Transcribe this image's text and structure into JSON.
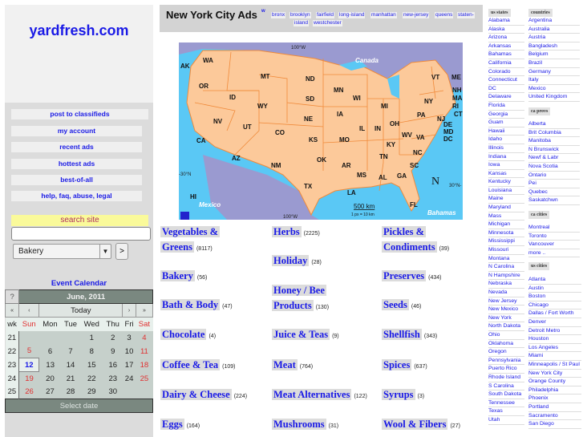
{
  "site": {
    "logo": "yardfresh.com"
  },
  "nav": [
    "post to classifieds",
    "my account",
    "recent ads",
    "hottest ads",
    "best-of-all",
    "help, faq, abuse, legal"
  ],
  "search": {
    "label": "search site",
    "query": "",
    "category_selected": "Bakery",
    "go_label": ">"
  },
  "calendar": {
    "title": "Event Calendar",
    "help": "?",
    "month": "June, 2011",
    "prev_year": "«",
    "prev_month": "‹",
    "today": "Today",
    "next_month": "›",
    "next_year": "»",
    "wk_label": "wk",
    "days": [
      "Sun",
      "Mon",
      "Tue",
      "Wed",
      "Thu",
      "Fri",
      "Sat"
    ],
    "weeks": [
      {
        "wk": "21",
        "d": [
          "",
          "",
          "",
          "1",
          "2",
          "3",
          "4"
        ]
      },
      {
        "wk": "22",
        "d": [
          "5",
          "6",
          "7",
          "8",
          "9",
          "10",
          "11"
        ]
      },
      {
        "wk": "23",
        "d": [
          "12",
          "13",
          "14",
          "15",
          "16",
          "17",
          "18"
        ]
      },
      {
        "wk": "24",
        "d": [
          "19",
          "20",
          "21",
          "22",
          "23",
          "24",
          "25"
        ]
      },
      {
        "wk": "25",
        "d": [
          "26",
          "27",
          "28",
          "29",
          "30",
          "",
          ""
        ]
      }
    ],
    "selected": "12",
    "footer": "Select date"
  },
  "header": {
    "title": "New York City Ads",
    "w_link": "w",
    "links": [
      "bronx",
      "brooklyn",
      "fairfield",
      "long-island",
      "manhattan",
      "new-jersey",
      "queens",
      "staten-",
      "island",
      "westchester"
    ]
  },
  "map": {
    "labels": {
      "canada": "Canada",
      "mexico": "Mexico",
      "bahamas": "Bahamas",
      "lon_top": "100°W",
      "lon_bottom": "100°W",
      "lat_left": "-30°N",
      "lat_right": "30°N-",
      "scale": "500 km",
      "scale_note": "1 px = 10 km",
      "north": "N",
      "hi": "HI",
      "ak": "AK"
    },
    "states": [
      "WA",
      "OR",
      "CA",
      "ID",
      "NV",
      "MT",
      "WY",
      "UT",
      "AZ",
      "CO",
      "NM",
      "ND",
      "SD",
      "NE",
      "KS",
      "OK",
      "TX",
      "MN",
      "IA",
      "MO",
      "AR",
      "LA",
      "WI",
      "IL",
      "MS",
      "MI",
      "IN",
      "KY",
      "TN",
      "AL",
      "OH",
      "GA",
      "FL",
      "SC",
      "NC",
      "VA",
      "WV",
      "PA",
      "NY",
      "VT",
      "ME",
      "NH",
      "MA",
      "RI",
      "CT",
      "NJ",
      "DE",
      "MD",
      "DC"
    ]
  },
  "categories": [
    {
      "name": "Vegetables &",
      "name2": "Greens",
      "count": "(8117)"
    },
    {
      "name": "Bakery",
      "count": "(56)"
    },
    {
      "name": "Bath & Body",
      "count": "(47)"
    },
    {
      "name": "Chocolate",
      "count": "(4)"
    },
    {
      "name": "Coffee & Tea",
      "count": "(109)"
    },
    {
      "name": "Dairy & Cheese",
      "count": "(224)"
    },
    {
      "name": "Eggs",
      "count": "(164)"
    },
    {
      "name": "Herbs",
      "count": "(2225)"
    },
    {
      "name": "Holiday",
      "count": "(28)"
    },
    {
      "name": "Honey / Bee",
      "name2": "Products",
      "count": "(130)"
    },
    {
      "name": "Juice & Teas",
      "count": "(9)"
    },
    {
      "name": "Meat",
      "count": "(764)"
    },
    {
      "name": "Meat Alternatives",
      "count": "(122)"
    },
    {
      "name": "Mushrooms",
      "count": "(31)"
    },
    {
      "name": "Pickles &",
      "name2": "Condiments",
      "count": "(39)"
    },
    {
      "name": "Preserves",
      "count": "(434)"
    },
    {
      "name": "Seeds",
      "count": "(46)"
    },
    {
      "name": "Shellfish",
      "count": "(343)"
    },
    {
      "name": "Spices",
      "count": "(637)"
    },
    {
      "name": "Syrups",
      "count": "(3)"
    },
    {
      "name": "Wool & Fibers",
      "count": "(27)"
    }
  ],
  "right": {
    "us_states_head": "us states",
    "us_states": [
      "Alabama",
      "Alaska",
      "Arizona",
      "Arkansas",
      "Bahamas",
      "California",
      "Colorado",
      "Connecticut",
      "DC",
      "Delaware",
      "Florida",
      "Georgia",
      "Guam",
      "Hawaii",
      "Idaho",
      "Illinois",
      "Indiana",
      "Iowa",
      "Kansas",
      "Kentucky",
      "Louisiana",
      "Maine",
      "Maryland",
      "Mass",
      "Michigan",
      "Minnesota",
      "Mississippi",
      "Missouri",
      "Montana",
      "N Carolina",
      "N Hampshire",
      "Nebraska",
      "Nevada",
      "New Jersey",
      "New Mexico",
      "New York",
      "North Dakota",
      "Ohio",
      "Oklahoma",
      "Oregon",
      "Pennsylvania",
      "Puerto Rico",
      "Rhode Island",
      "S Carolina",
      "South Dakota",
      "Tennessee",
      "Texas",
      "Utah"
    ],
    "countries_head": "countries",
    "countries": [
      "Argentina",
      "Australia",
      "Austria",
      "Bangladesh",
      "Belgium",
      "Brazil",
      "Germany",
      "Italy",
      "Mexico",
      "United Kingdom"
    ],
    "ca_provs_head": "ca provs",
    "ca_provs": [
      "Alberta",
      "Brit Columbia",
      "Manitoba",
      "N Brunswick",
      "Newf & Labr",
      "Nova Scotia",
      "Ontario",
      "Pei",
      "Quebec",
      "Saskatchwn"
    ],
    "ca_cities_head": "ca cities",
    "ca_cities": [
      "Montreal",
      "Toronto",
      "Vancouver",
      "more .."
    ],
    "us_cities_head": "us cities",
    "us_cities": [
      "Atlanta",
      "Austin",
      "Boston",
      "Chicago",
      "Dallas / Fort Worth",
      "Denver",
      "Detroit Metro",
      "Houston",
      "Los Angeles",
      "Miami",
      "Minneapolis / St Paul",
      "New York City",
      "Orange County",
      "Philadelphia",
      "Phoenix",
      "Portland",
      "Sacramento",
      "San Diego"
    ]
  },
  "colors": {
    "link": "#1a1ae6",
    "weekend": "#e03030",
    "map_land": "#fcc99a",
    "map_water": "#5ac8f5",
    "map_foreign": "#9a9ad0"
  }
}
